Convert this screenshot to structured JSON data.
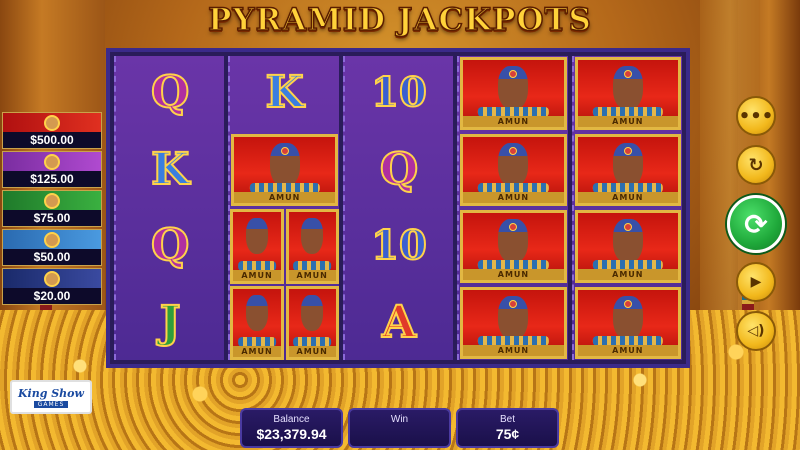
{
  "title": "PYRAMID JACKPOTS",
  "jackpots": [
    {
      "amount": "$500.00"
    },
    {
      "amount": "$125.00"
    },
    {
      "amount": "$75.00"
    },
    {
      "amount": "$50.00"
    },
    {
      "amount": "$20.00"
    }
  ],
  "reels": [
    [
      "Q",
      "K",
      "Q",
      "J"
    ],
    [
      "K",
      "AMUN",
      "AMUN",
      "AMUN"
    ],
    [
      "10",
      "Q",
      "10",
      "A"
    ],
    [
      "AMUN",
      "AMUN",
      "AMUN",
      "AMUN"
    ],
    [
      "AMUN",
      "AMUN",
      "AMUN",
      "AMUN"
    ]
  ],
  "symbol_label": "AMUN",
  "logo": {
    "name": "King Show",
    "sub": "GAMES"
  },
  "panels": {
    "balance": {
      "label": "Balance",
      "value": "$23,379.94"
    },
    "win": {
      "label": "Win",
      "value": ""
    },
    "bet": {
      "label": "Bet",
      "value": "75¢"
    }
  },
  "controls": [
    {
      "name": "menu-button",
      "icon": "ellipsis-icon",
      "glyph": "•••"
    },
    {
      "name": "autoplay-button",
      "icon": "autoplay-icon",
      "glyph": "↻"
    },
    {
      "name": "spin-button",
      "icon": "spin-icon",
      "glyph": "⟳"
    },
    {
      "name": "play-info-button",
      "icon": "play-circle-icon",
      "glyph": "▶"
    },
    {
      "name": "sound-button",
      "icon": "speaker-icon",
      "glyph": "◁)"
    }
  ]
}
